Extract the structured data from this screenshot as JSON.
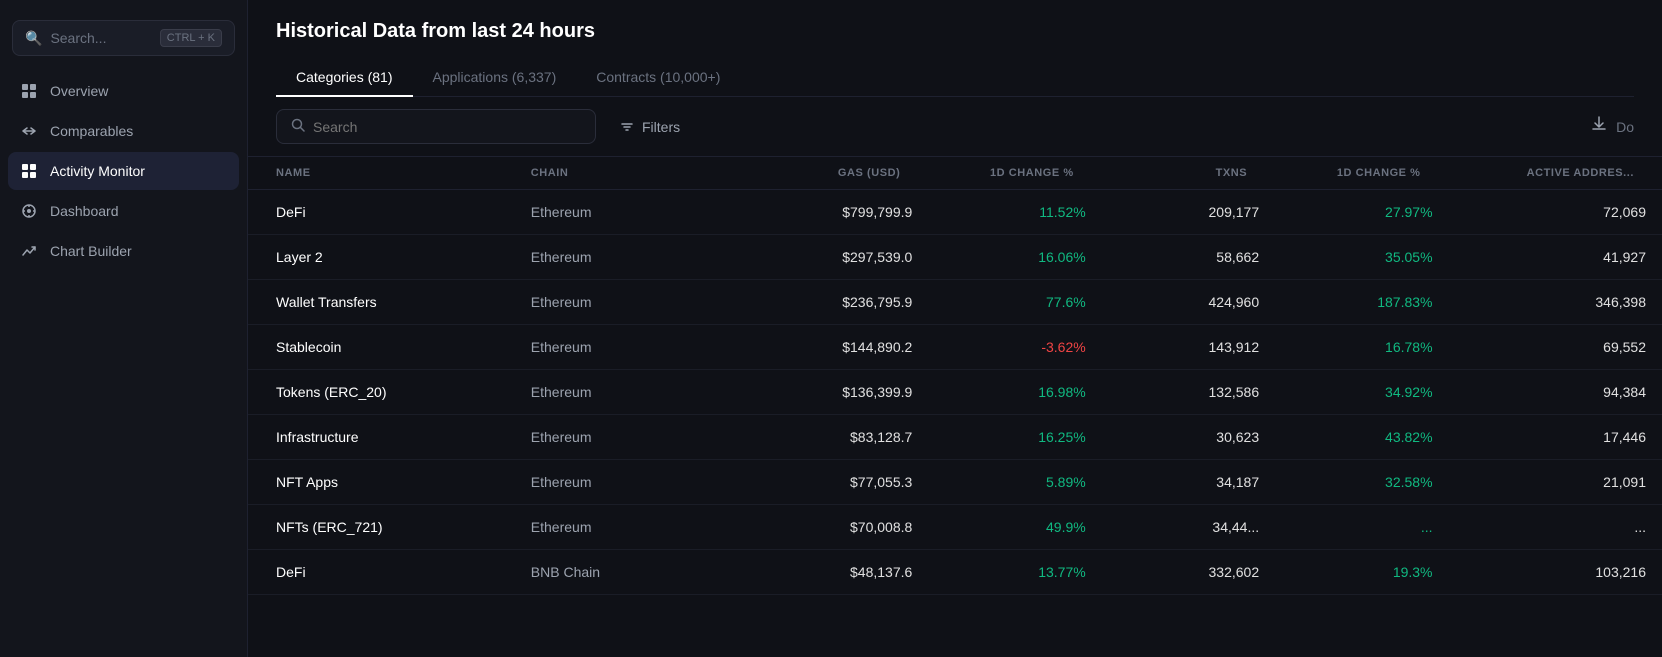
{
  "sidebar": {
    "search": {
      "placeholder": "Search...",
      "shortcut": "CTRL + K"
    },
    "items": [
      {
        "id": "overview",
        "label": "Overview",
        "icon": "⊞",
        "active": false
      },
      {
        "id": "comparables",
        "label": "Comparables",
        "icon": "⇄",
        "active": false
      },
      {
        "id": "activity-monitor",
        "label": "Activity Monitor",
        "icon": "▦",
        "active": true
      },
      {
        "id": "dashboard",
        "label": "Dashboard",
        "icon": "❖",
        "active": false
      },
      {
        "id": "chart-builder",
        "label": "Chart Builder",
        "icon": "↗",
        "active": false
      }
    ]
  },
  "page": {
    "title": "Historical Data from last 24 hours"
  },
  "tabs": [
    {
      "id": "categories",
      "label": "Categories (81)",
      "active": true
    },
    {
      "id": "applications",
      "label": "Applications (6,337)",
      "active": false
    },
    {
      "id": "contracts",
      "label": "Contracts (10,000+)",
      "active": false
    }
  ],
  "toolbar": {
    "search_placeholder": "Search",
    "filters_label": "Filters",
    "download_label": "Do"
  },
  "table": {
    "columns": [
      {
        "id": "name",
        "label": "NAME"
      },
      {
        "id": "chain",
        "label": "CHAIN"
      },
      {
        "id": "gas",
        "label": "GAS (USD)"
      },
      {
        "id": "gas_change",
        "label": "1D CHANGE %"
      },
      {
        "id": "txns",
        "label": "TXNS"
      },
      {
        "id": "txns_change",
        "label": "1D CHANGE %"
      },
      {
        "id": "active_addresses",
        "label": "ACTIVE ADDRES..."
      }
    ],
    "rows": [
      {
        "name": "DeFi",
        "chain": "Ethereum",
        "gas": "$799,799.9",
        "gas_change": "11.52%",
        "gas_change_positive": true,
        "txns": "209,177",
        "txns_change": "27.97%",
        "txns_change_positive": true,
        "active_addresses": "72,069"
      },
      {
        "name": "Layer 2",
        "chain": "Ethereum",
        "gas": "$297,539.0",
        "gas_change": "16.06%",
        "gas_change_positive": true,
        "txns": "58,662",
        "txns_change": "35.05%",
        "txns_change_positive": true,
        "active_addresses": "41,927"
      },
      {
        "name": "Wallet Transfers",
        "chain": "Ethereum",
        "gas": "$236,795.9",
        "gas_change": "77.6%",
        "gas_change_positive": true,
        "txns": "424,960",
        "txns_change": "187.83%",
        "txns_change_positive": true,
        "active_addresses": "346,398"
      },
      {
        "name": "Stablecoin",
        "chain": "Ethereum",
        "gas": "$144,890.2",
        "gas_change": "-3.62%",
        "gas_change_positive": false,
        "txns": "143,912",
        "txns_change": "16.78%",
        "txns_change_positive": true,
        "active_addresses": "69,552"
      },
      {
        "name": "Tokens (ERC_20)",
        "chain": "Ethereum",
        "gas": "$136,399.9",
        "gas_change": "16.98%",
        "gas_change_positive": true,
        "txns": "132,586",
        "txns_change": "34.92%",
        "txns_change_positive": true,
        "active_addresses": "94,384"
      },
      {
        "name": "Infrastructure",
        "chain": "Ethereum",
        "gas": "$83,128.7",
        "gas_change": "16.25%",
        "gas_change_positive": true,
        "txns": "30,623",
        "txns_change": "43.82%",
        "txns_change_positive": true,
        "active_addresses": "17,446"
      },
      {
        "name": "NFT Apps",
        "chain": "Ethereum",
        "gas": "$77,055.3",
        "gas_change": "5.89%",
        "gas_change_positive": true,
        "txns": "34,187",
        "txns_change": "32.58%",
        "txns_change_positive": true,
        "active_addresses": "21,091"
      },
      {
        "name": "NFTs (ERC_721)",
        "chain": "Ethereum",
        "gas": "$70,008.8",
        "gas_change": "49.9%",
        "gas_change_positive": true,
        "txns": "34,44...",
        "txns_change": "...",
        "txns_change_positive": true,
        "active_addresses": "..."
      },
      {
        "name": "DeFi",
        "chain": "BNB Chain",
        "gas": "$48,137.6",
        "gas_change": "13.77%",
        "gas_change_positive": true,
        "txns": "332,602",
        "txns_change": "19.3%",
        "txns_change_positive": true,
        "active_addresses": "103,216"
      }
    ]
  }
}
